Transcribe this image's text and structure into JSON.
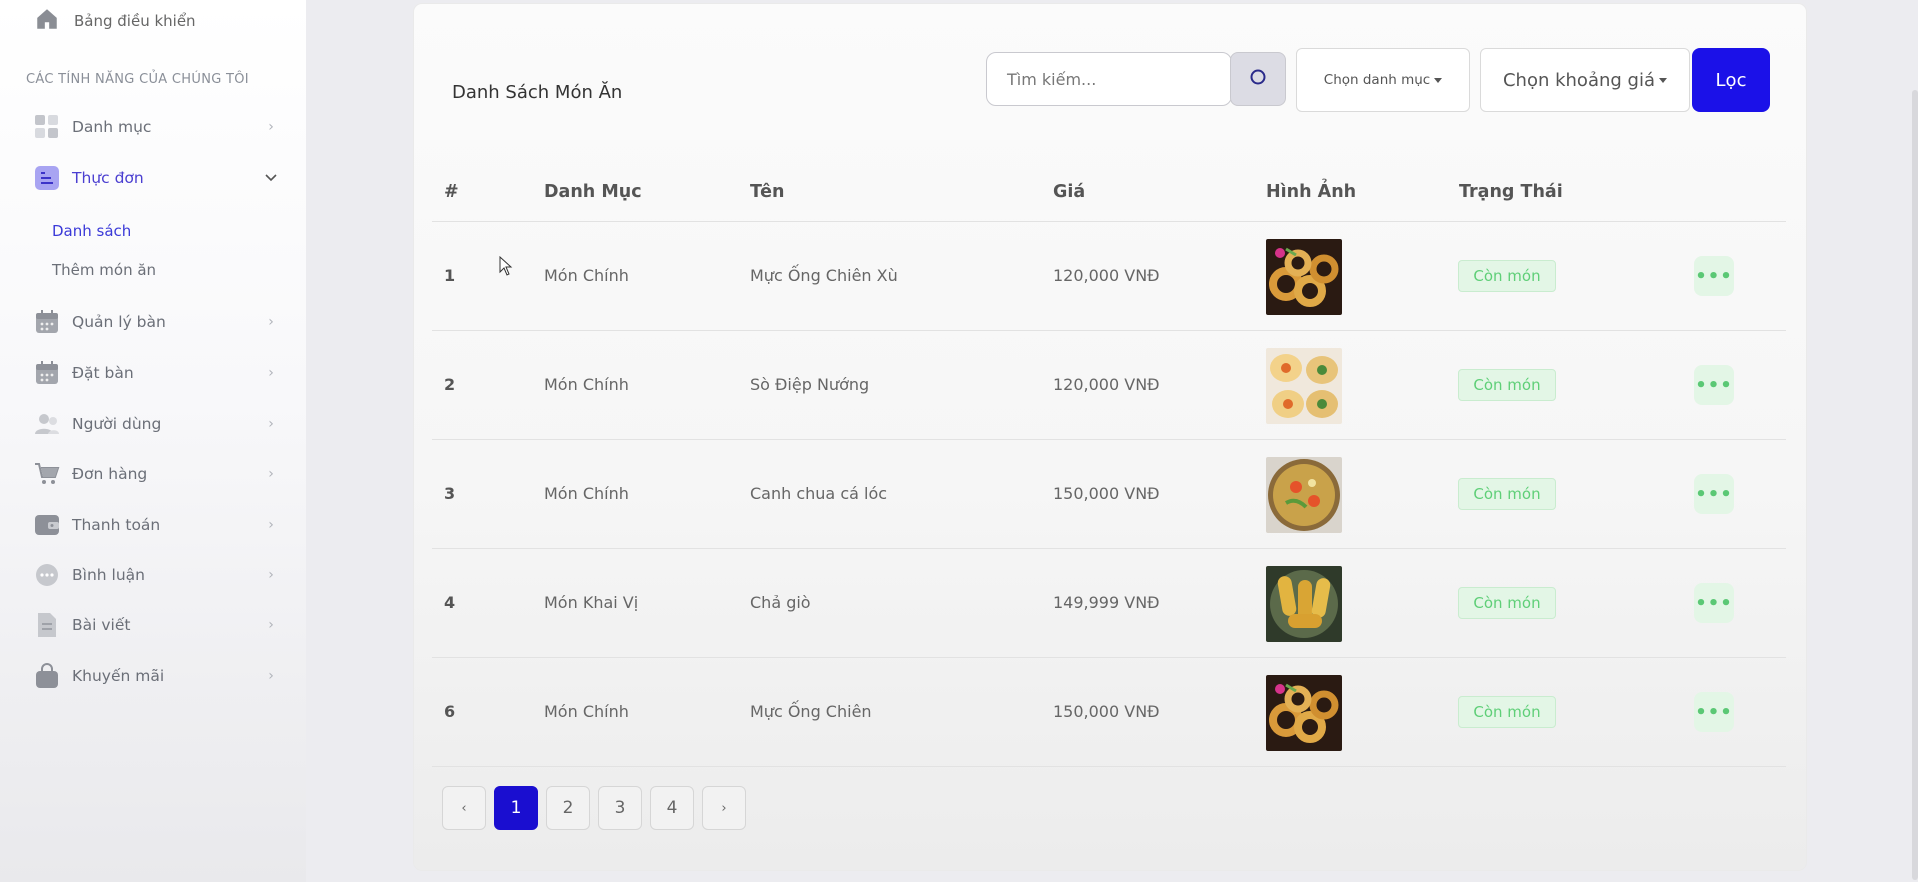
{
  "sidebar": {
    "dashboard_label": "Bảng điều khiển",
    "section_title": "CÁC TÍNH NĂNG CỦA CHÚNG TÔI",
    "items": [
      {
        "label": "Danh mục",
        "icon": "grid-icon"
      },
      {
        "label": "Thực đơn",
        "icon": "menu-list-icon",
        "active": true
      },
      {
        "label": "Quản lý bàn",
        "icon": "calendar-icon"
      },
      {
        "label": "Đặt bàn",
        "icon": "calendar-icon"
      },
      {
        "label": "Người dùng",
        "icon": "users-icon"
      },
      {
        "label": "Đơn hàng",
        "icon": "cart-icon"
      },
      {
        "label": "Thanh toán",
        "icon": "wallet-icon"
      },
      {
        "label": "Bình luận",
        "icon": "chat-icon"
      },
      {
        "label": "Bài viết",
        "icon": "document-icon"
      },
      {
        "label": "Khuyến mãi",
        "icon": "bag-icon"
      }
    ],
    "sub_items": [
      {
        "label": "Danh sách",
        "active": true
      },
      {
        "label": "Thêm món ăn"
      }
    ]
  },
  "main": {
    "title": "Danh Sách Món Ăn",
    "search_placeholder": "Tìm kiếm...",
    "category_dropdown": "Chọn danh mục",
    "price_dropdown": "Chọn khoảng giá",
    "filter_label": "Lọc",
    "accent_color": "#1b11e8"
  },
  "table": {
    "headers": [
      "#",
      "Danh Mục",
      "Tên",
      "Giá",
      "Hình Ảnh",
      "Trạng Thái"
    ],
    "rows": [
      {
        "id": "1",
        "category": "Món Chính",
        "name": "Mực Ống Chiên Xù",
        "price": "120,000 VNĐ",
        "image": "fried-squid",
        "status": "Còn món"
      },
      {
        "id": "2",
        "category": "Món Chính",
        "name": "Sò Điệp Nướng",
        "price": "120,000 VNĐ",
        "image": "grilled-scallops",
        "status": "Còn món"
      },
      {
        "id": "3",
        "category": "Món Chính",
        "name": "Canh chua cá lóc",
        "price": "150,000 VNĐ",
        "image": "sour-soup",
        "status": "Còn món"
      },
      {
        "id": "4",
        "category": "Món Khai Vị",
        "name": "Chả giò",
        "price": "149,999 VNĐ",
        "image": "spring-rolls",
        "status": "Còn món"
      },
      {
        "id": "6",
        "category": "Món Chính",
        "name": "Mực Ống Chiên",
        "price": "150,000 VNĐ",
        "image": "fried-squid",
        "status": "Còn món"
      }
    ]
  },
  "pagination": {
    "prev": "‹",
    "pages": [
      "1",
      "2",
      "3",
      "4"
    ],
    "current": "1",
    "next": "›"
  }
}
